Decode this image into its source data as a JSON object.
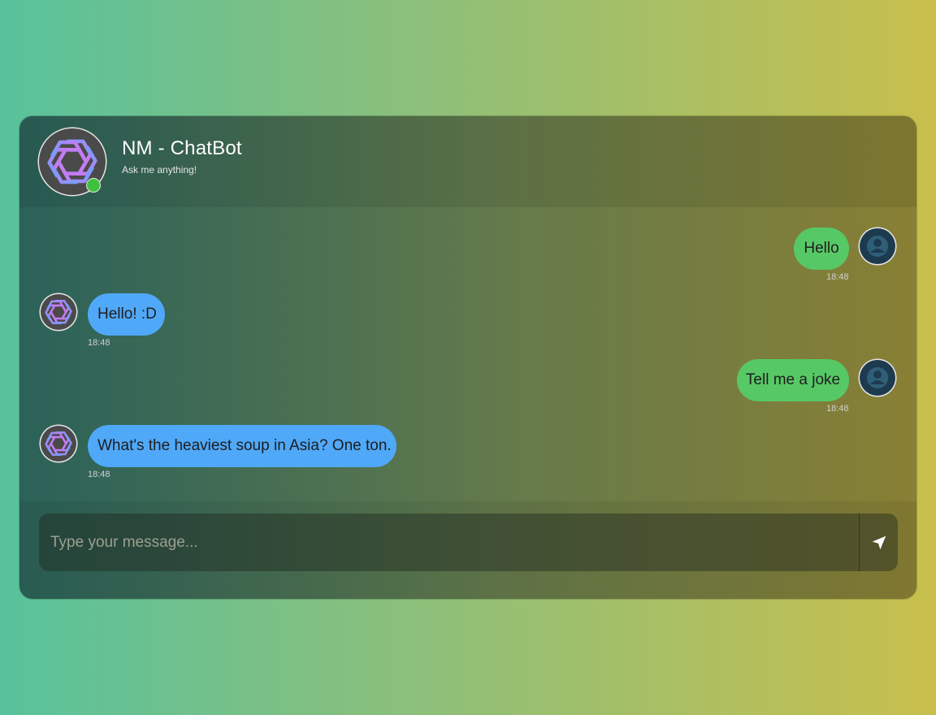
{
  "header": {
    "title": "NM - ChatBot",
    "subtitle": "Ask me anything!",
    "bot_avatar_icon": "openai-logo-icon",
    "status": "online",
    "status_color": "#3ec23e"
  },
  "messages": [
    {
      "sender": "user",
      "text": "Hello",
      "time": "18:48"
    },
    {
      "sender": "bot",
      "text": "Hello! :D",
      "time": "18:48"
    },
    {
      "sender": "user",
      "text": "Tell me a joke",
      "time": "18:48"
    },
    {
      "sender": "bot",
      "text": "What's the heaviest soup in Asia? One ton.",
      "time": "18:48"
    }
  ],
  "composer": {
    "placeholder": "Type your message...",
    "value": "",
    "send_icon": "send-arrow-icon"
  },
  "colors": {
    "user_bubble": "#57c866",
    "bot_bubble": "#50a8f8",
    "background_start": "#58c29c",
    "background_end": "#c8bf4c"
  }
}
